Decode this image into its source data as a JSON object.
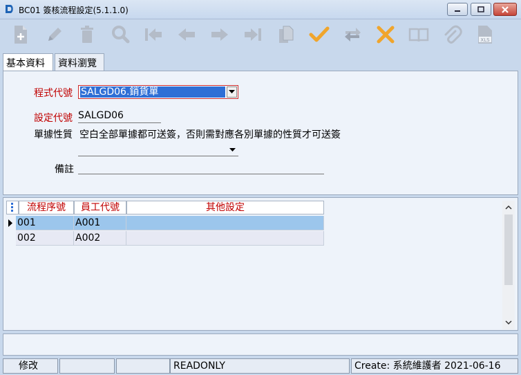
{
  "window": {
    "title": "BC01 簽核流程設定(5.1.1.0)"
  },
  "toolbar": {
    "buttons": [
      {
        "name": "new-icon"
      },
      {
        "name": "edit-icon"
      },
      {
        "name": "delete-icon"
      },
      {
        "name": "search-icon"
      },
      {
        "name": "first-record-icon"
      },
      {
        "name": "previous-record-icon"
      },
      {
        "name": "next-record-icon"
      },
      {
        "name": "last-record-icon"
      },
      {
        "name": "copy-icon"
      },
      {
        "name": "confirm-icon"
      },
      {
        "name": "refresh-icon"
      },
      {
        "name": "cancel-icon"
      },
      {
        "name": "book-icon"
      },
      {
        "name": "attachment-icon"
      },
      {
        "name": "export-xls-icon"
      }
    ]
  },
  "tabs": [
    {
      "label": "基本資料"
    },
    {
      "label": "資料瀏覽"
    }
  ],
  "form": {
    "program_code_label": "程式代號",
    "program_code_value": "SALGD06.銷貨單",
    "setting_code_label": "設定代號",
    "setting_code_value": "SALGD06",
    "doc_nature_label": "單據性質",
    "doc_nature_hint": "空白全部單據都可送簽，否則需對應各別單據的性質才可送簽",
    "doc_nature_value": "",
    "remark_label": "備註",
    "remark_value": ""
  },
  "grid": {
    "columns": [
      "流程序號",
      "員工代號",
      "其他設定"
    ],
    "rows": [
      {
        "seq": "001",
        "emp": "A001",
        "other": ""
      },
      {
        "seq": "002",
        "emp": "A002",
        "other": ""
      }
    ]
  },
  "status": {
    "mode": "修改",
    "cell2": "",
    "cell3": "",
    "readonly": "READONLY",
    "create_info": "Create: 系統維護者 2021-06-16"
  },
  "colors": {
    "accent_red": "#c00000",
    "selected_row": "#9cc6ec",
    "window_bg": "#c8d8ec"
  }
}
